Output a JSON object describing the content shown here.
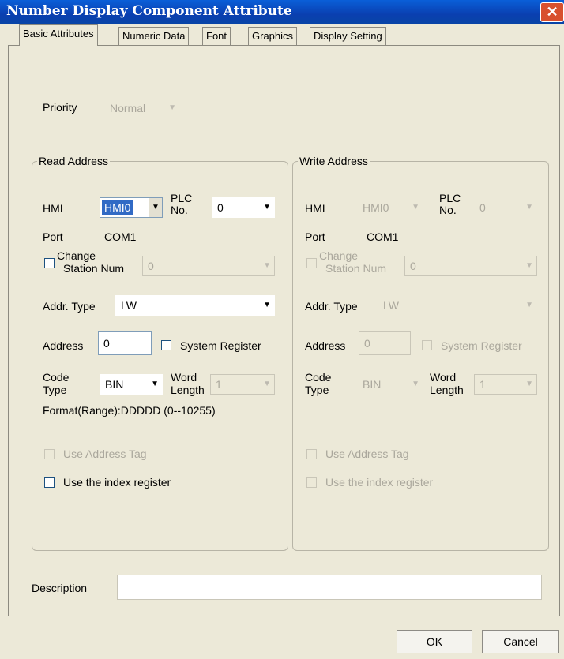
{
  "window": {
    "title": "Number Display Component Attribute",
    "close_symbol": "✕"
  },
  "tabs": [
    {
      "label": "Basic Attributes",
      "active": true
    },
    {
      "label": "Numeric Data",
      "active": false
    },
    {
      "label": "Font",
      "active": false
    },
    {
      "label": "Graphics",
      "active": false
    },
    {
      "label": "Display Setting",
      "active": false
    }
  ],
  "priority": {
    "label": "Priority",
    "value": "Normal",
    "enabled": false
  },
  "read_address": {
    "legend": "Read Address",
    "hmi_label": "HMI",
    "hmi_value": "HMI0",
    "plc_label_1": "PLC",
    "plc_label_2": "No.",
    "plc_value": "0",
    "port_label": "Port",
    "port_value": "COM1",
    "change_station_label_1": "Change",
    "change_station_label_2": "Station Num",
    "change_station_checked": false,
    "change_station_value": "0",
    "addr_type_label": "Addr. Type",
    "addr_type_value": "LW",
    "address_label": "Address",
    "address_value": "0",
    "system_register_label": "System Register",
    "system_register_checked": false,
    "code_type_label_1": "Code",
    "code_type_label_2": "Type",
    "code_type_value": "BIN",
    "word_length_label_1": "Word",
    "word_length_label_2": "Length",
    "word_length_value": "1",
    "format_text": "Format(Range):DDDDD (0--10255)",
    "use_address_tag_label": "Use Address Tag",
    "use_index_register_label": "Use the index register"
  },
  "write_address": {
    "legend": "Write Address",
    "hmi_label": "HMI",
    "hmi_value": "HMI0",
    "plc_label_1": "PLC",
    "plc_label_2": "No.",
    "plc_value": "0",
    "port_label": "Port",
    "port_value": "COM1",
    "change_station_label_1": "Change",
    "change_station_label_2": "Station Num",
    "change_station_value": "0",
    "addr_type_label": "Addr. Type",
    "addr_type_value": "LW",
    "address_label": "Address",
    "address_value": "0",
    "system_register_label": "System Register",
    "code_type_label_1": "Code",
    "code_type_label_2": "Type",
    "code_type_value": "BIN",
    "word_length_label_1": "Word",
    "word_length_label_2": "Length",
    "word_length_value": "1",
    "use_address_tag_label": "Use Address Tag",
    "use_index_register_label": "Use the index register"
  },
  "description": {
    "label": "Description",
    "value": ""
  },
  "buttons": {
    "ok": "OK",
    "cancel": "Cancel"
  },
  "icons": {
    "dropdown_arrow": "▼"
  },
  "colors": {
    "titlebar": "#0a4fc8",
    "close": "#d8502e",
    "selection": "#316ac5",
    "disabled_text": "#aaa79c"
  }
}
